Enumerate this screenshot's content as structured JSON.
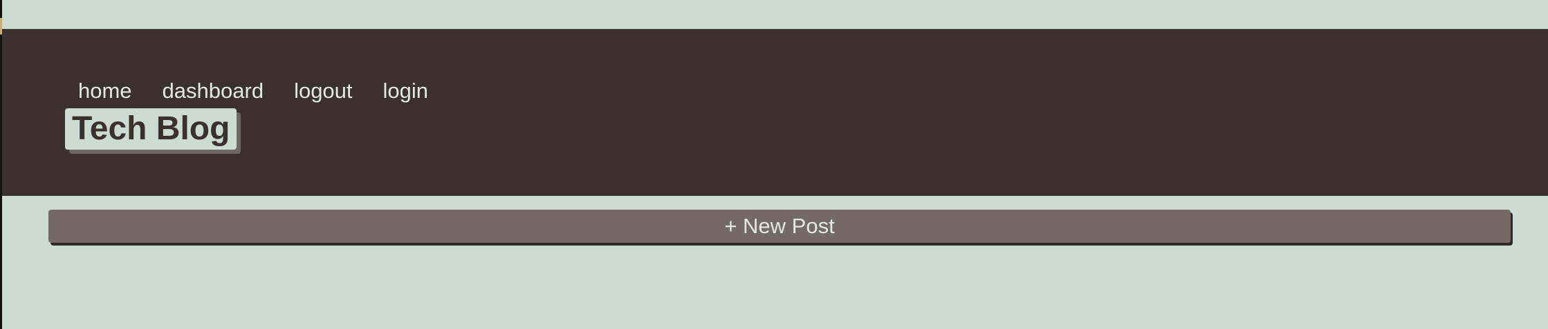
{
  "nav": {
    "items": [
      {
        "label": "home"
      },
      {
        "label": "dashboard"
      },
      {
        "label": "logout"
      },
      {
        "label": "login"
      }
    ]
  },
  "brand": {
    "title": "Tech Blog"
  },
  "actions": {
    "new_post_label": "+ New Post"
  },
  "colors": {
    "page_background": "#cddcd2",
    "header_background": "#3a302f",
    "button_background": "#736a68",
    "nav_text": "#e4e8e4",
    "brand_text": "#3a302f"
  }
}
